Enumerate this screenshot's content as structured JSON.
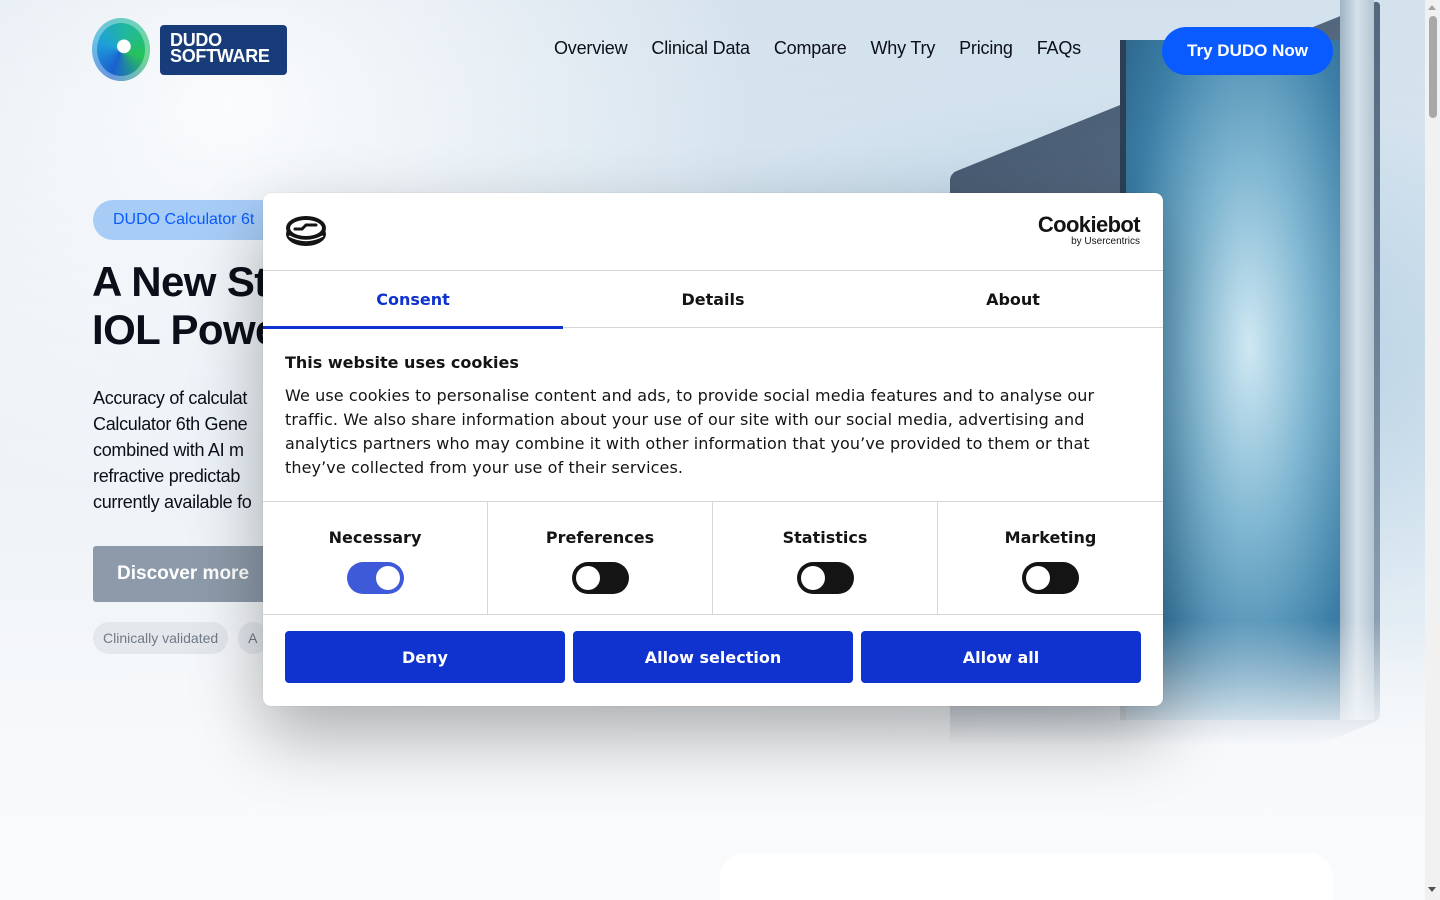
{
  "header": {
    "logo_line1": "DUDO",
    "logo_line2": "SOFTWARE",
    "nav": [
      "Overview",
      "Clinical Data",
      "Compare",
      "Why Try",
      "Pricing",
      "FAQs"
    ],
    "cta_label": "Try DUDO Now"
  },
  "hero": {
    "pill": "DUDO Calculator 6t",
    "title_line1": "A New St",
    "title_line2": "IOL Powe",
    "text_lines": [
      "Accuracy of calculat",
      "Calculator 6th Gene",
      "combined with AI m",
      "refractive predictab",
      "currently available fo"
    ],
    "discover_label": "Discover more",
    "tags": [
      "Clinically validated",
      "A"
    ]
  },
  "cookie_dialog": {
    "brand_name": "Cookiebot",
    "brand_sub": "by Usercentrics",
    "tabs": [
      "Consent",
      "Details",
      "About"
    ],
    "active_tab": "Consent",
    "heading": "This website uses cookies",
    "body": "We use cookies to personalise content and ads, to provide social media features and to analyse our traffic. We also share information about your use of our site with our social media, advertising and analytics partners who may combine it with other information that you’ve provided to them or that they’ve collected from your use of their services.",
    "toggles": [
      {
        "label": "Necessary",
        "on": true
      },
      {
        "label": "Preferences",
        "on": false
      },
      {
        "label": "Statistics",
        "on": false
      },
      {
        "label": "Marketing",
        "on": false
      }
    ],
    "buttons": {
      "deny": "Deny",
      "allow_selection": "Allow selection",
      "allow_all": "Allow all"
    }
  },
  "colors": {
    "accent_blue": "#0a5bff",
    "cookiebot_blue": "#1032cf",
    "logo_navy": "#183c7a"
  }
}
